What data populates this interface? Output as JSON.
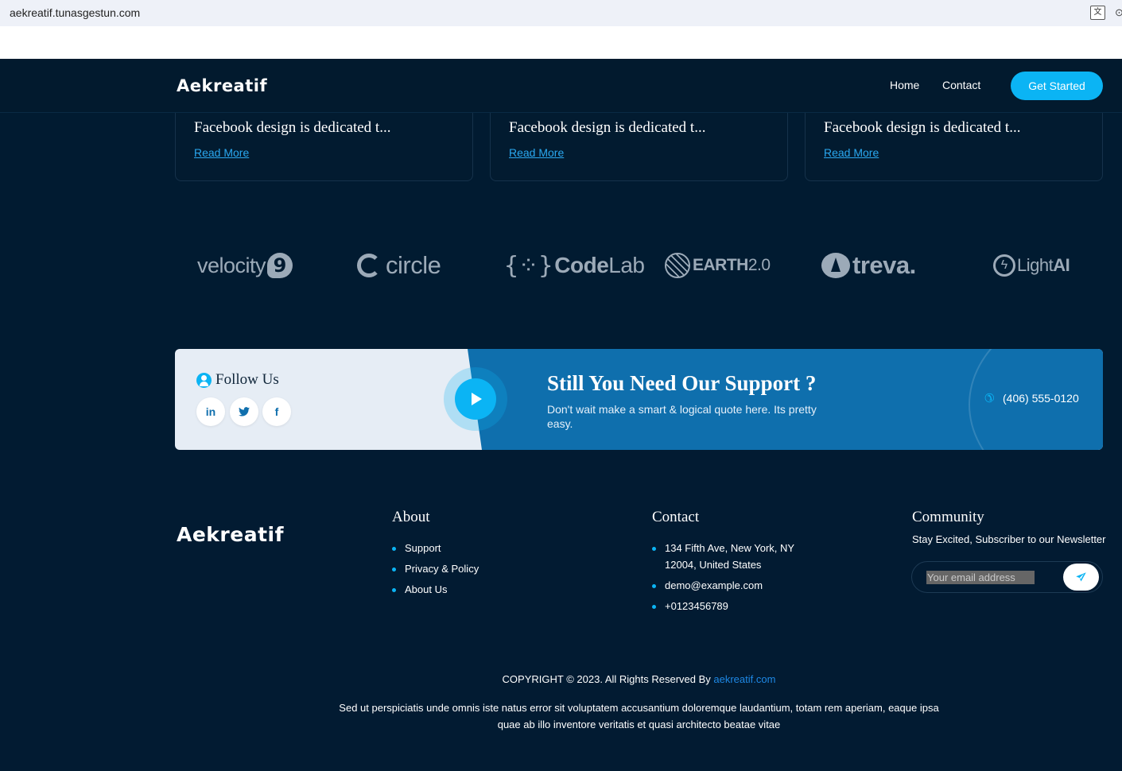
{
  "browser": {
    "url": "aekreatif.tunasgestun.com"
  },
  "header": {
    "logo": "Aekreatif",
    "nav": [
      "Home",
      "Contact"
    ],
    "cta": "Get Started"
  },
  "cards": [
    {
      "title": "Facebook design is dedicated t...",
      "link": "Read More"
    },
    {
      "title": "Facebook design is dedicated t...",
      "link": "Read More"
    },
    {
      "title": "Facebook design is dedicated t...",
      "link": "Read More"
    }
  ],
  "brands": {
    "velocity": "velocity",
    "velocity_badge": "9",
    "circle": "circle",
    "codelab_bold": "Code",
    "codelab_light": "Lab",
    "earth_bold": "EARTH",
    "earth_light": "2.0",
    "treva": "treva.",
    "lightai_light": "Light",
    "lightai_bold": "AI"
  },
  "support": {
    "follow_title": "Follow Us",
    "social": [
      "in",
      "t",
      "f"
    ],
    "title": "Still You Need Our Support ?",
    "description": "Don't wait make a smart & logical quote here. Its pretty easy.",
    "phone": "(406) 555-0120"
  },
  "footer": {
    "logo": "Aekreatif",
    "about": {
      "title": "About",
      "items": [
        "Support",
        "Privacy & Policy",
        "About Us"
      ]
    },
    "contact": {
      "title": "Contact",
      "items": [
        "134 Fifth Ave, New York, NY 12004, United States",
        "demo@example.com",
        "+0123456789"
      ]
    },
    "community": {
      "title": "Community",
      "text": "Stay Excited, Subscriber to our Newsletter",
      "placeholder": "Your email address"
    },
    "copyright_prefix": "COPYRIGHT © 2023. All Rights Reserved By",
    "copyright_link": "aekreatif.com",
    "lorem": "Sed ut perspiciatis unde omnis iste natus error sit voluptatem accusantium doloremque laudantium, totam rem aperiam, eaque ipsa quae ab illo inventore veritatis et quasi architecto beatae vitae"
  },
  "colors": {
    "background": "#011b31",
    "accent": "#0bb4f4",
    "banner_blue": "#0f6fad",
    "link": "#2aa8f0"
  }
}
